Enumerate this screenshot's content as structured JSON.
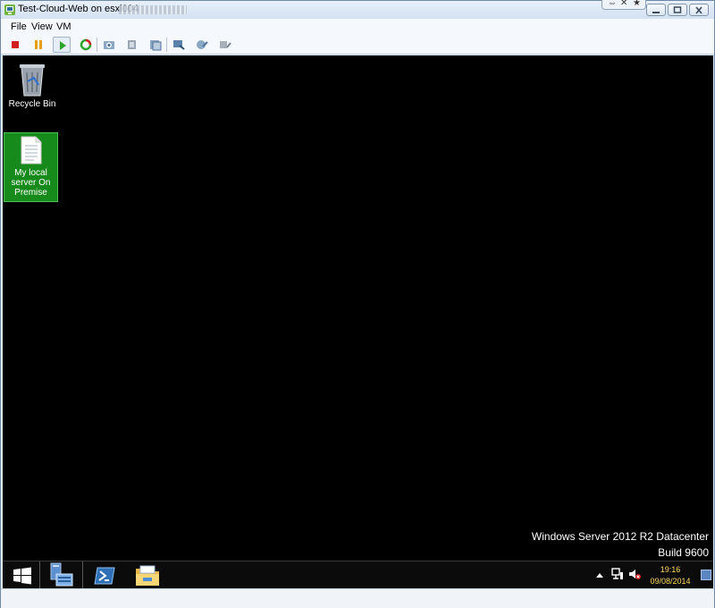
{
  "window": {
    "title": "Test-Cloud-Web on esxi004",
    "extra_buttons": [
      "⇔",
      "✕",
      "★"
    ]
  },
  "menu": {
    "items": [
      "File",
      "View",
      "VM"
    ]
  },
  "toolbar": {
    "buttons": [
      "stop-icon",
      "pause-icon",
      "play-icon",
      "reset-icon",
      "snapshot-icon",
      "revert-snapshot-icon",
      "manage-snapshots-icon",
      "console-fullscreen-icon",
      "connect-device-icon",
      "disconnect-device-icon"
    ]
  },
  "desktop": {
    "icons": [
      {
        "label": "Recycle Bin"
      },
      {
        "label": "My local server On Premise"
      }
    ],
    "watermark": {
      "line1": "Windows Server 2012 R2 Datacenter",
      "line2": "Build 9600"
    }
  },
  "taskbar": {
    "apps": [
      "start-icon",
      "server-manager-icon",
      "powershell-icon",
      "file-explorer-icon"
    ],
    "clock": {
      "time": "19:16",
      "date": "09/08/2014"
    },
    "tray": [
      "show-hidden-icons",
      "network-icon",
      "volume-muted-icon"
    ]
  },
  "colors": {
    "desktop_bg": "#000000",
    "selected_icon_bg": "#168a1a",
    "window_chrome": "#dfe9f5"
  }
}
